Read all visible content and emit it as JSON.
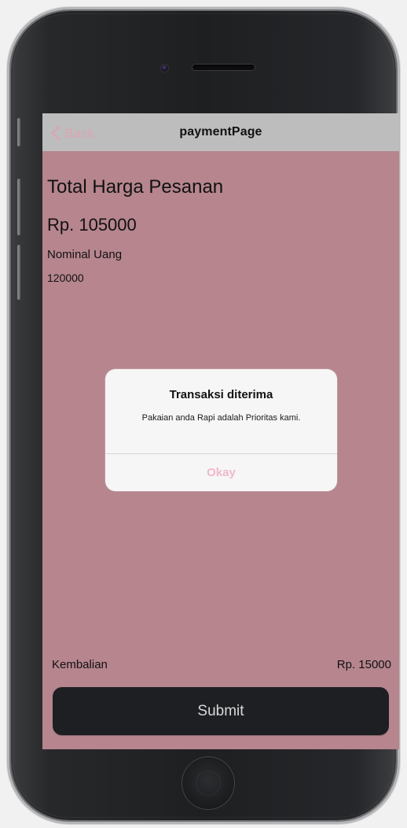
{
  "navigation": {
    "back_label": "Back",
    "title": "paymentPage",
    "back_icon": "chevron-left-icon"
  },
  "content": {
    "total_title": "Total Harga Pesanan",
    "total_value": "Rp. 105000",
    "nominal_label": "Nominal Uang",
    "nominal_value": "120000",
    "change_label": "Kembalian",
    "change_value": "Rp. 15000"
  },
  "actions": {
    "submit_label": "Submit"
  },
  "alert": {
    "title": "Transaksi diterima",
    "message": "Pakaian anda Rapi adalah Prioritas kami.",
    "button_label": "Okay"
  },
  "colors": {
    "screen_background": "#b6858e",
    "navbar_background": "#bdbdbd",
    "accent_pink": "#f1b7c9",
    "submit_background": "#1d1f22"
  }
}
